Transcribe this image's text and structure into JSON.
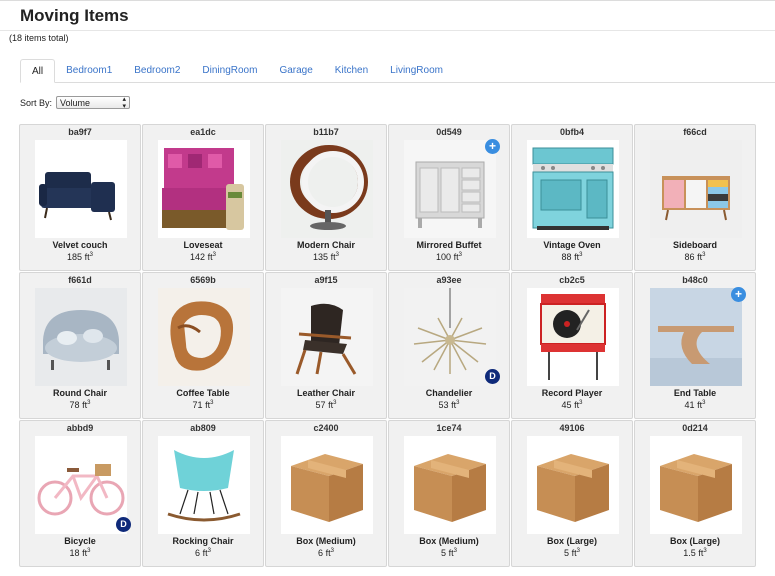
{
  "page": {
    "title": "Moving Items",
    "count_text": "(18 items total)"
  },
  "tabs": [
    "All",
    "Bedroom1",
    "Bedroom2",
    "DiningRoom",
    "Garage",
    "Kitchen",
    "LivingRoom"
  ],
  "active_tab": "All",
  "sort": {
    "label": "Sort By:",
    "value": "Volume"
  },
  "volume_unit": "ft",
  "volume_exponent": "3",
  "items": [
    {
      "code": "ba9f7",
      "name": "Velvet couch",
      "volume": "185",
      "icon": "couch-image"
    },
    {
      "code": "ea1dc",
      "name": "Loveseat",
      "volume": "142",
      "icon": "loveseat-image"
    },
    {
      "code": "b11b7",
      "name": "Modern Chair",
      "volume": "135",
      "icon": "ring-chair-image"
    },
    {
      "code": "0d549",
      "name": "Mirrored Buffet",
      "volume": "100",
      "icon": "buffet-image",
      "badge": "+"
    },
    {
      "code": "0bfb4",
      "name": "Vintage Oven",
      "volume": "88",
      "icon": "oven-image"
    },
    {
      "code": "f66cd",
      "name": "Sideboard",
      "volume": "86",
      "icon": "sideboard-image"
    },
    {
      "code": "f661d",
      "name": "Round Chair",
      "volume": "78",
      "icon": "round-chair-image"
    },
    {
      "code": "6569b",
      "name": "Coffee Table",
      "volume": "71",
      "icon": "coffee-table-image"
    },
    {
      "code": "a9f15",
      "name": "Leather Chair",
      "volume": "57",
      "icon": "leather-chair-image"
    },
    {
      "code": "a93ee",
      "name": "Chandelier",
      "volume": "53",
      "icon": "chandelier-image",
      "badge": "D"
    },
    {
      "code": "cb2c5",
      "name": "Record Player",
      "volume": "45",
      "icon": "record-player-image"
    },
    {
      "code": "b48c0",
      "name": "End Table",
      "volume": "41",
      "icon": "end-table-image",
      "badge": "+"
    },
    {
      "code": "abbd9",
      "name": "Bicycle",
      "volume": "18",
      "icon": "bicycle-image",
      "badge": "D"
    },
    {
      "code": "ab809",
      "name": "Rocking Chair",
      "volume": "6",
      "icon": "rocking-chair-image"
    },
    {
      "code": "c2400",
      "name": "Box (Medium)",
      "volume": "6",
      "icon": "box-image"
    },
    {
      "code": "1ce74",
      "name": "Box (Medium)",
      "volume": "5",
      "icon": "box-image"
    },
    {
      "code": "49106",
      "name": "Box (Large)",
      "volume": "5",
      "icon": "box-image"
    },
    {
      "code": "0d214",
      "name": "Box (Large)",
      "volume": "1.5",
      "icon": "box-image"
    }
  ],
  "colors": {
    "link": "#3a74c9",
    "plus_badge": "#3a8ee0",
    "d_badge": "#0f2a7a",
    "card_bg": "#f1f1f1"
  }
}
